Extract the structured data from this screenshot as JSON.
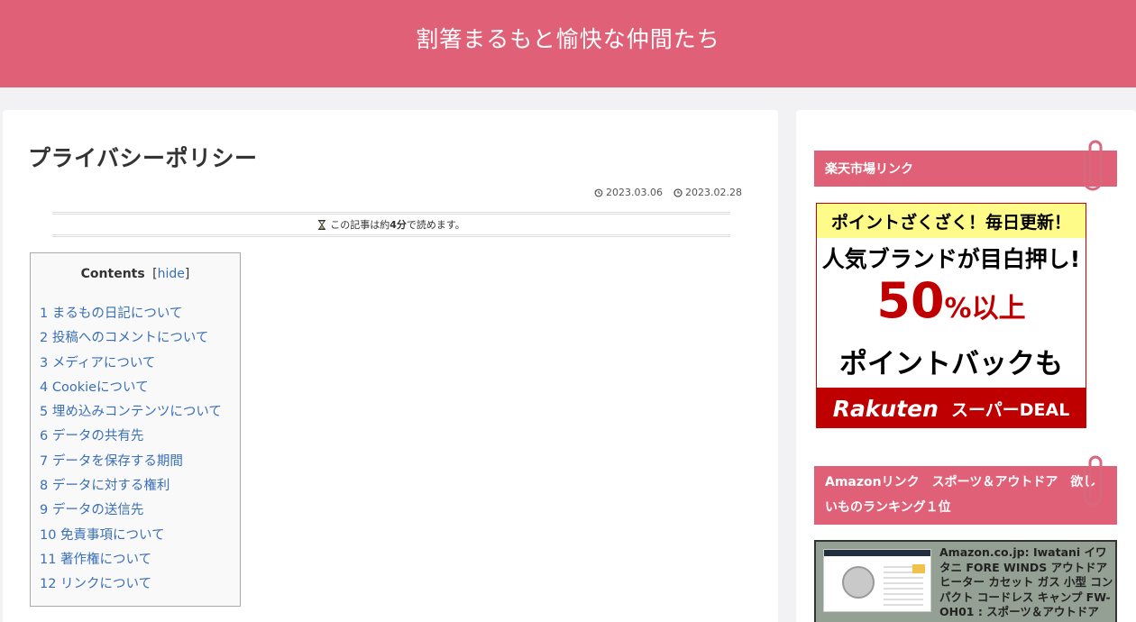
{
  "header": {
    "site_title": "割箸まるもと愉快な仲間たち"
  },
  "article": {
    "title": "プライバシーポリシー",
    "updated_date": "2023.03.06",
    "published_date": "2023.02.28",
    "reading_time": {
      "prefix": "この記事は約",
      "value": "4分",
      "suffix": "で読めます。"
    }
  },
  "toc": {
    "title": "Contents",
    "toggle_open": "[",
    "toggle_label": "hide",
    "toggle_close": "]",
    "items": [
      "1 まるもの日記について",
      "2 投稿へのコメントについて",
      "3 メディアについて",
      "4 Cookieについて",
      "5 埋め込みコンテンツについて",
      "6 データの共有先",
      "7 データを保存する期間",
      "8 データに対する権利",
      "9 データの送信先",
      "10 免責事項について",
      "11 著作権について",
      "12 リンクについて"
    ]
  },
  "sidebar": {
    "widget1_title": "楽天市場リンク",
    "banner": {
      "line1": "ポイントざくざく！毎日更新！",
      "line2": "人気ブランドが目白押し!",
      "big_number": "50",
      "big_suffix": "%以上",
      "line4": "ポイントバックも",
      "brand": "Rakuten",
      "brand_tag": "スーパーDEAL"
    },
    "widget2_title": "Amazonリンク　スポーツ＆アウトドア　欲しいものランキング１位",
    "amazon_card_text": "Amazon.co.jp: Iwatani イワタニ FORE WINDS アウトドア ヒーター カセット ガス 小型 コンパクト コードレス キャンプ FW-OH01 : スポーツ＆アウトドア"
  },
  "colors": {
    "brand": "#e06177",
    "link": "#3a6fb6",
    "rakuten_red": "#bf0000"
  },
  "icons": {
    "updated": "history-icon",
    "published": "clock-icon",
    "reading": "hourglass-icon",
    "widget": "paperclip-icon"
  }
}
